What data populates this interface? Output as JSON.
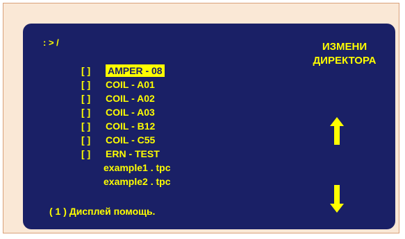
{
  "screen": {
    "prompt": ": > /",
    "title_line1": "ИЗМЕНИ",
    "title_line2": "ДИРЕКТОРА",
    "help": "( 1 ) Дисплей помощь."
  },
  "entries": [
    {
      "marker": "[  ]",
      "name": "AMPER - 08",
      "selected": true
    },
    {
      "marker": "[  ]",
      "name": "COIL - A01"
    },
    {
      "marker": "[  ]",
      "name": "COIL - A02"
    },
    {
      "marker": "[  ]",
      "name": "COIL - A03"
    },
    {
      "marker": "[  ]",
      "name": "COIL - B12"
    },
    {
      "marker": "[  ]",
      "name": "COIL - C55"
    },
    {
      "marker": "[  ]",
      "name": "ERN - TEST"
    },
    {
      "name": "example1 . tpc"
    },
    {
      "name": "example2 . tpc"
    }
  ],
  "icons": {
    "up": "arrow-up-icon",
    "down": "arrow-down-icon"
  },
  "colors": {
    "page_background": "#fae8d6",
    "screen_background": "#1a2066",
    "text": "#ffff00",
    "highlight_text": "#1a2066"
  }
}
